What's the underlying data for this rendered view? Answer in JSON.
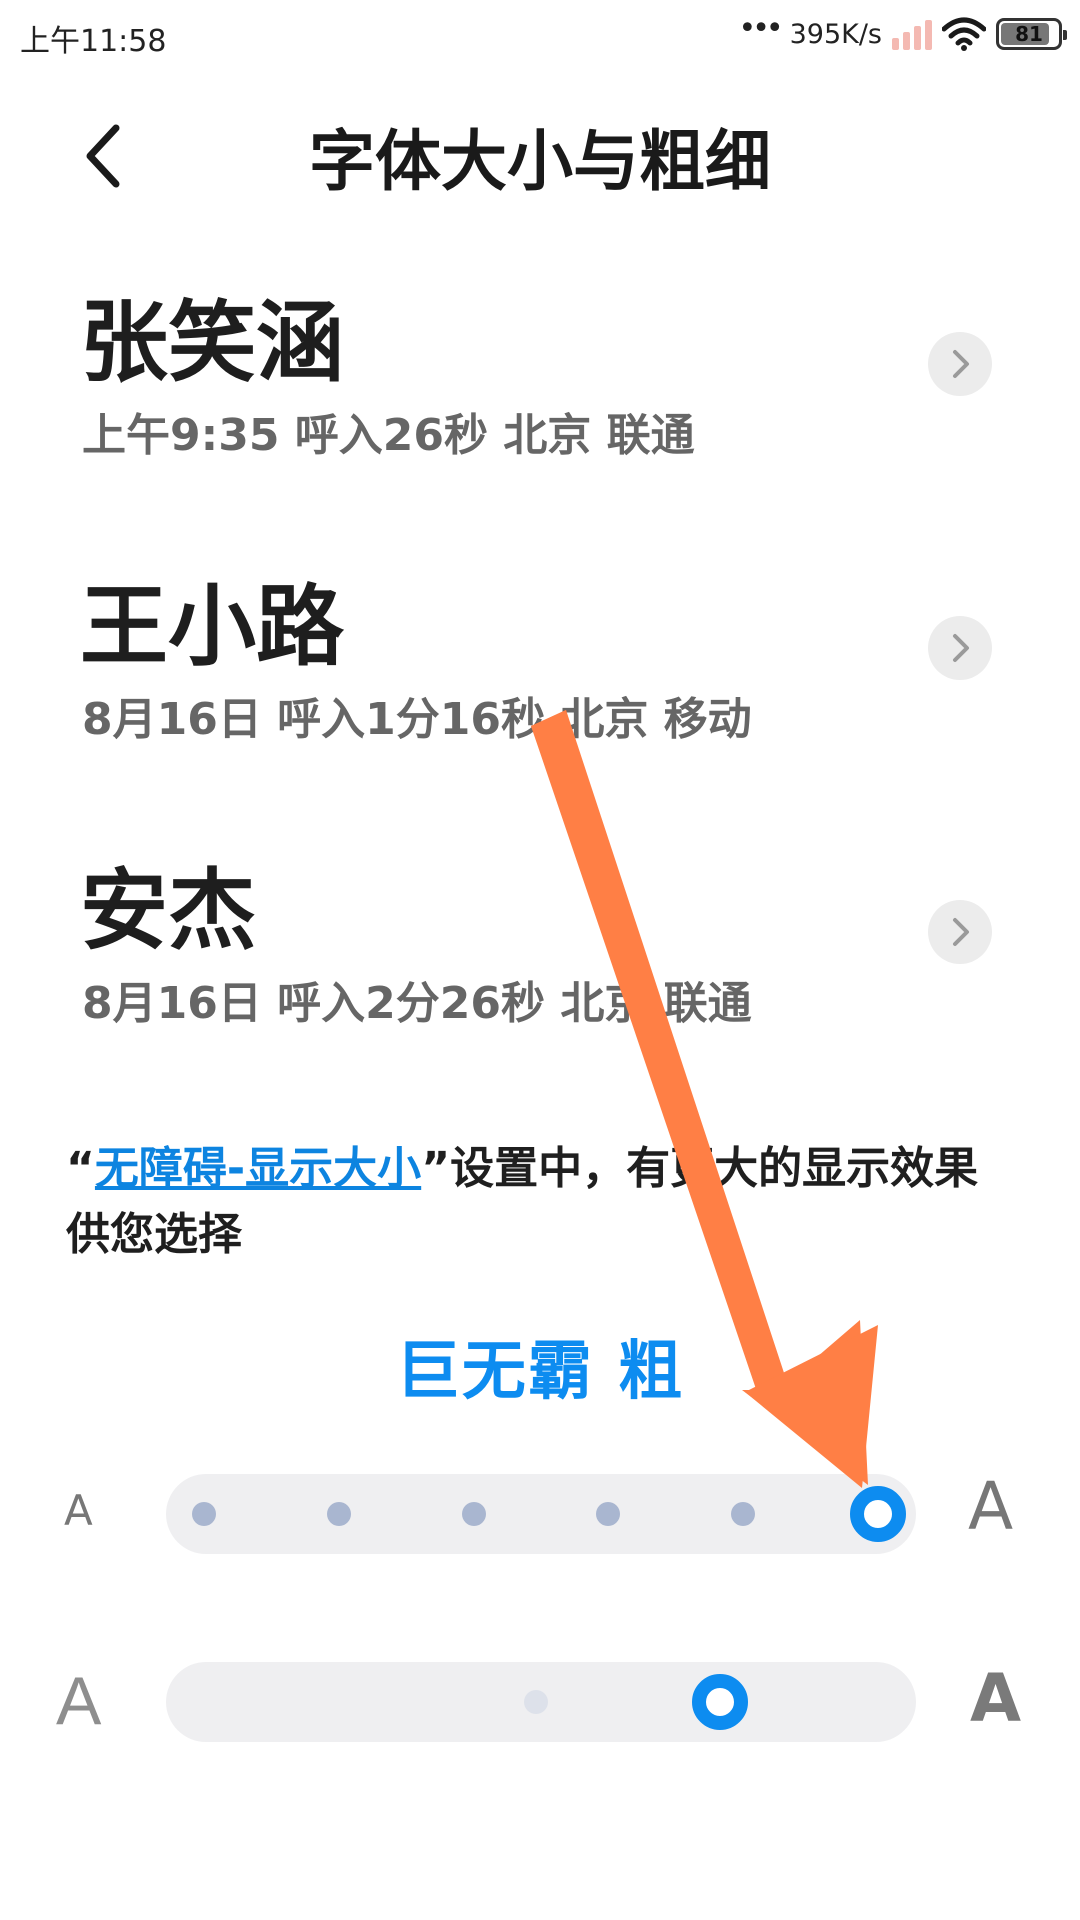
{
  "status_bar": {
    "time": "上午11:58",
    "dots": "•••",
    "net_speed": "395K/s",
    "battery": "81"
  },
  "header": {
    "title": "字体大小与粗细",
    "back_icon": "chevron-left-icon"
  },
  "calls": [
    {
      "name": "张笑涵",
      "detail": "上午9:35 呼入26秒 北京 联通"
    },
    {
      "name": "王小路",
      "detail": "8月16日 呼入1分16秒 北京 移动"
    },
    {
      "name": "安杰",
      "detail": "8月16日 呼入2分26秒 北京 联通"
    }
  ],
  "notice": {
    "open_quote": "“",
    "link": "无障碍-显示大小",
    "rest": "”设置中，有更大的显示效果供您选择"
  },
  "size_label": "巨无霸 粗",
  "size_slider": {
    "min_label": "A",
    "max_label": "A",
    "steps": 6,
    "selected_index": 5
  },
  "weight_slider": {
    "min_label": "A",
    "max_label": "A",
    "steps": 2,
    "selected_index": 1
  },
  "colors": {
    "accent": "#0d8cf0",
    "link": "#0d84e0",
    "annotation_arrow": "#ff7f45"
  }
}
